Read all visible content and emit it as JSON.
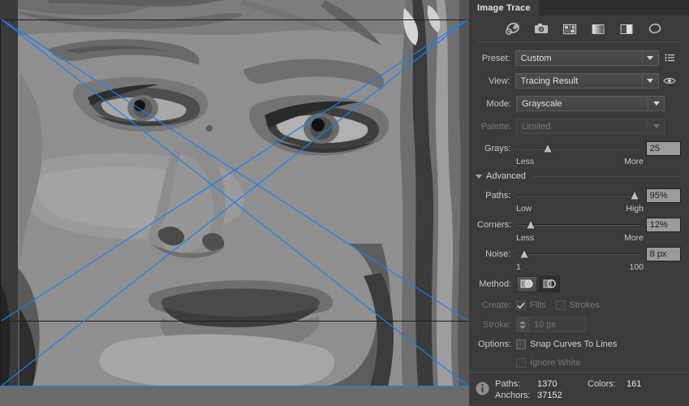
{
  "panel": {
    "tab_label": "Image Trace",
    "icon_strip": [
      {
        "name": "auto-color-icon",
        "title": "Auto-Color"
      },
      {
        "name": "high-color-icon",
        "title": "High Color"
      },
      {
        "name": "low-color-icon",
        "title": "Low Color"
      },
      {
        "name": "grayscale-icon",
        "title": "Grayscale"
      },
      {
        "name": "black-and-white-icon",
        "title": "Black and White"
      },
      {
        "name": "outline-icon",
        "title": "Outline"
      }
    ],
    "preset": {
      "label": "Preset:",
      "value": "Custom",
      "menu_icon": "preset-menu-icon"
    },
    "view": {
      "label": "View:",
      "value": "Tracing Result",
      "toggle_icon": "eye-icon"
    },
    "mode": {
      "label": "Mode:",
      "value": "Grayscale"
    },
    "palette": {
      "label": "Palette:",
      "value": "Limited",
      "disabled": true
    },
    "grays": {
      "label": "Grays:",
      "value": "25",
      "min_label": "Less",
      "max_label": "More",
      "thumb_percent": 26
    },
    "advanced": {
      "label": "Advanced",
      "expanded": true
    },
    "paths": {
      "label": "Paths:",
      "value": "95%",
      "min_label": "Low",
      "max_label": "High",
      "thumb_percent": 95
    },
    "corners": {
      "label": "Corners:",
      "value": "12%",
      "min_label": "Less",
      "max_label": "More",
      "thumb_percent": 12
    },
    "noise": {
      "label": "Noise:",
      "value": "8 px",
      "min_label": "1",
      "max_label": "100",
      "thumb_percent": 7
    },
    "method": {
      "label": "Method:",
      "option_abutting": "abutting-method-icon",
      "option_overlapping": "overlapping-method-icon",
      "selected": "overlapping"
    },
    "create": {
      "label": "Create:",
      "fills_label": "Fills",
      "fills_checked": true,
      "strokes_label": "Strokes",
      "strokes_checked": false,
      "disabled": true
    },
    "stroke": {
      "label": "Stroke:",
      "value": "10 px",
      "disabled": true
    },
    "options": {
      "label": "Options:",
      "snap_label": "Snap Curves To Lines",
      "snap_checked": false,
      "ignore_white_label": "Ignore White",
      "ignore_white_checked": false,
      "ignore_white_disabled": true
    },
    "status": {
      "info_icon": "info-icon",
      "paths_label": "Paths:",
      "paths_value": "1370",
      "colors_label": "Colors:",
      "colors_value": "161",
      "anchors_label": "Anchors:",
      "anchors_value": "37152"
    }
  },
  "canvas": {
    "artwork_name": "traced-portrait-grayscale",
    "selection_color": "#1a7ff5",
    "background_color": "#6b6b6b"
  }
}
